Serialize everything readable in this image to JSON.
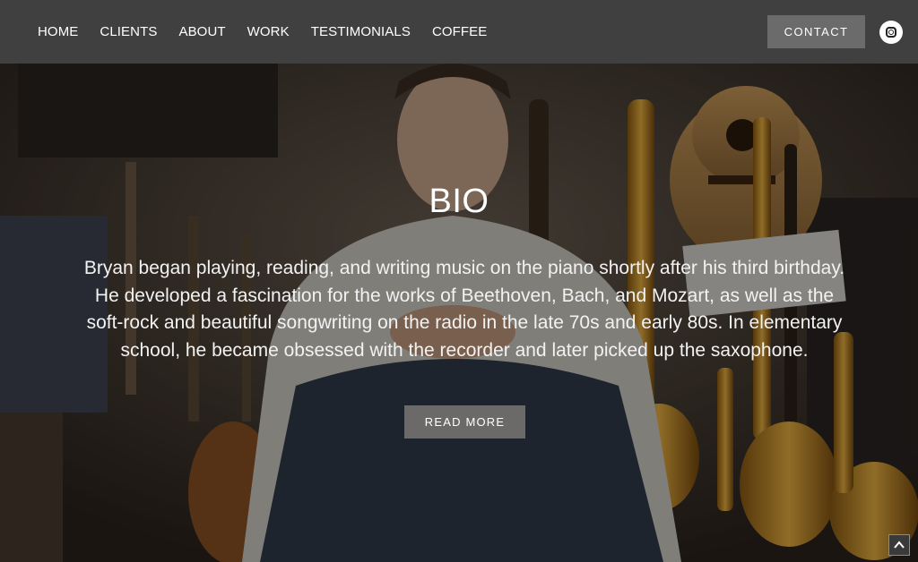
{
  "nav": {
    "items": [
      {
        "label": "HOME"
      },
      {
        "label": "CLIENTS"
      },
      {
        "label": "ABOUT"
      },
      {
        "label": "WORK"
      },
      {
        "label": "TESTIMONIALS"
      },
      {
        "label": "COFFEE"
      }
    ],
    "contact_label": "CONTACT",
    "social_icon": "instagram-icon"
  },
  "hero": {
    "title": "BIO",
    "text": "Bryan began playing, reading, and writing music on the piano shortly after his third birthday. He developed a fascination for the works of Beethoven, Bach, and Mozart, as well as the soft-rock and beautiful songwriting on the radio in the late 70s and early 80s. In elementary school, he became obsessed with the recorder and later picked up the saxophone.",
    "button_label": "READ MORE"
  },
  "scroll_top_icon": "chevron-up-icon",
  "colors": {
    "navbar": "#404040",
    "contact_button": "#6b6b6b",
    "read_more_button": "#6c6a68"
  }
}
